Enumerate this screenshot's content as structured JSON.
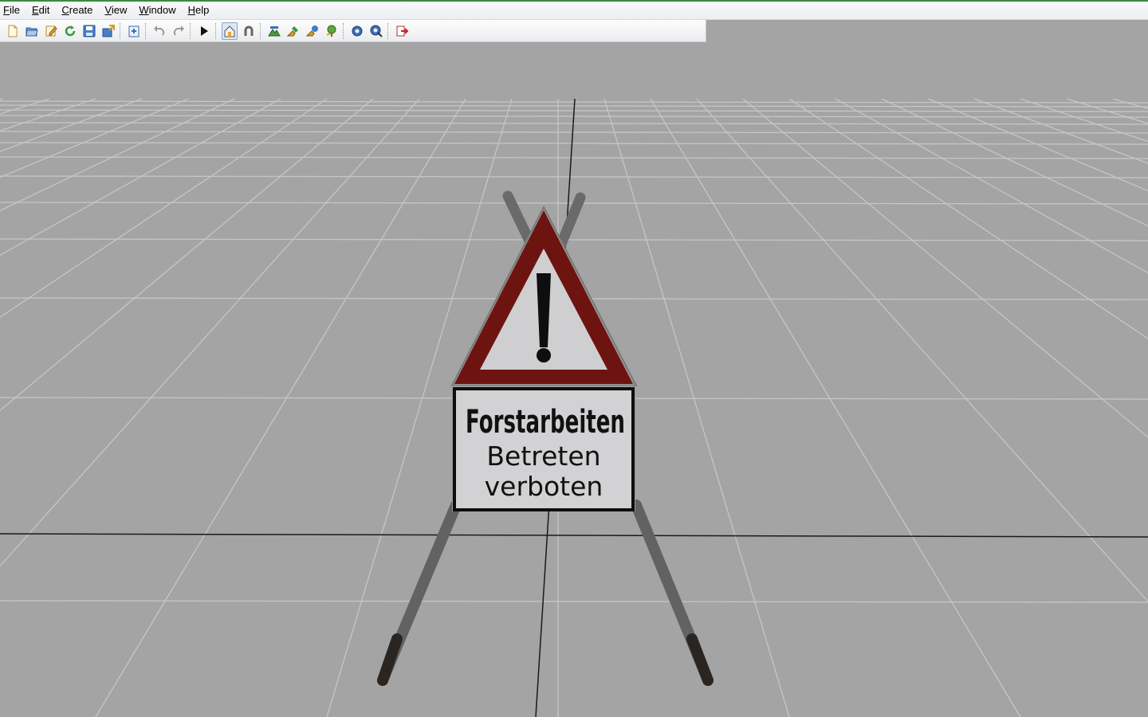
{
  "menu": {
    "file": "File",
    "edit": "Edit",
    "create": "Create",
    "view": "View",
    "window": "Window",
    "help": "Help"
  },
  "toolbar": {
    "buttons": [
      "new-file-icon",
      "open-folder-icon",
      "edit-icon",
      "refresh-icon",
      "save-icon",
      "export-icon",
      "import-icon",
      "undo-icon",
      "redo-icon",
      "play-icon",
      "home-view-icon",
      "magnet-icon",
      "terrain-tool-icon",
      "paint-tool-icon",
      "foliage-tool-icon",
      "tree-tool-icon",
      "settings-gear-icon",
      "settings-user-icon",
      "exit-icon"
    ]
  },
  "sign": {
    "line1": "Forstarbeiten",
    "line2": "Betreten",
    "line3": "verboten",
    "warning_symbol": "!"
  },
  "colors": {
    "viewport_bg": "#a4a4a4",
    "grid_line": "#c4c4c4",
    "triangle_red": "#6e1410",
    "sign_face": "#cfcfd1"
  }
}
